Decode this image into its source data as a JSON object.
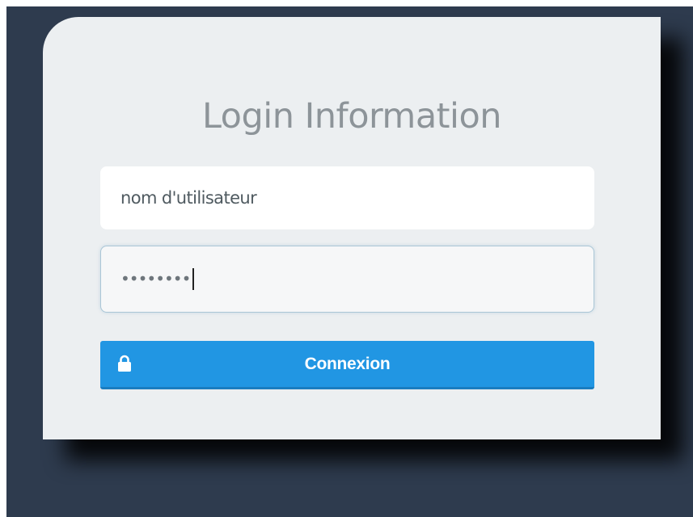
{
  "login": {
    "title": "Login Information",
    "username_placeholder": "nom d'utilisateur",
    "password_masked": "••••••••",
    "submit_label": "Connexion",
    "submit_icon": "lock-icon"
  },
  "colors": {
    "backdrop": "#2e3b4e",
    "panel": "#eceff1",
    "button": "#2196e3",
    "title_text": "#8d9499"
  }
}
